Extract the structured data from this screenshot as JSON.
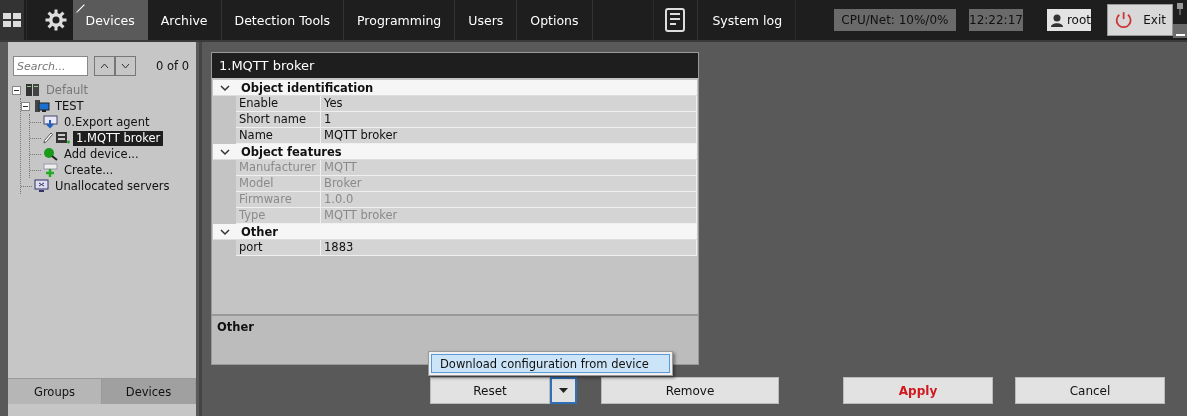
{
  "top_bar": {
    "tabs": [
      {
        "label": "Devices",
        "selected": true
      },
      {
        "label": "Archive",
        "selected": false
      },
      {
        "label": "Detection Tools",
        "selected": false
      },
      {
        "label": "Programming",
        "selected": false
      },
      {
        "label": "Users",
        "selected": false
      },
      {
        "label": "Options",
        "selected": false
      }
    ],
    "system_log": "System log",
    "cpu_net": "CPU/Net: 10%/0%",
    "clock": "12:22:17",
    "user": "root",
    "exit": "Exit"
  },
  "sidebar": {
    "search": {
      "placeholder": "Search..."
    },
    "match_count": "0 of 0",
    "tree": [
      {
        "label": "Default",
        "kind": "server",
        "disabled": true,
        "selected": false,
        "expanded": true,
        "children": [
          {
            "label": "TEST",
            "kind": "computer",
            "disabled": false,
            "selected": false,
            "expanded": true,
            "children": [
              {
                "label": "0.Export agent",
                "kind": "agent",
                "disabled": false,
                "selected": false
              },
              {
                "label": "1.MQTT broker",
                "kind": "device",
                "disabled": false,
                "selected": true
              },
              {
                "label": "Add device...",
                "kind": "add",
                "disabled": false,
                "selected": false
              },
              {
                "label": "Create...",
                "kind": "create",
                "disabled": false,
                "selected": false
              }
            ]
          },
          {
            "label": "Unallocated servers",
            "kind": "monitor",
            "disabled": false,
            "selected": false
          }
        ]
      }
    ],
    "tabs": [
      {
        "label": "Groups",
        "selected": false
      },
      {
        "label": "Devices",
        "selected": true
      }
    ]
  },
  "properties": {
    "title": "1.MQTT broker",
    "groups": [
      {
        "name": "Object identification",
        "expanded": true,
        "rows": [
          {
            "name": "Enable",
            "value": "Yes",
            "disabled": false
          },
          {
            "name": "Short name",
            "value": "1",
            "disabled": false
          },
          {
            "name": "Name",
            "value": "MQTT broker",
            "disabled": false
          }
        ]
      },
      {
        "name": "Object features",
        "expanded": true,
        "rows": [
          {
            "name": "Manufacturer",
            "value": "MQTT",
            "disabled": true
          },
          {
            "name": "Model",
            "value": "Broker",
            "disabled": true
          },
          {
            "name": "Firmware",
            "value": "1.0.0",
            "disabled": true
          },
          {
            "name": "Type",
            "value": "MQTT broker",
            "disabled": true
          }
        ]
      },
      {
        "name": "Other",
        "expanded": true,
        "rows": [
          {
            "name": "port",
            "value": "1883",
            "disabled": false
          }
        ]
      }
    ],
    "description_title": "Other"
  },
  "actions": {
    "reset": "Reset",
    "menu": [
      {
        "label": "Download configuration from device",
        "selected": true
      }
    ],
    "remove": "Remove",
    "apply": "Apply",
    "cancel": "Cancel"
  }
}
